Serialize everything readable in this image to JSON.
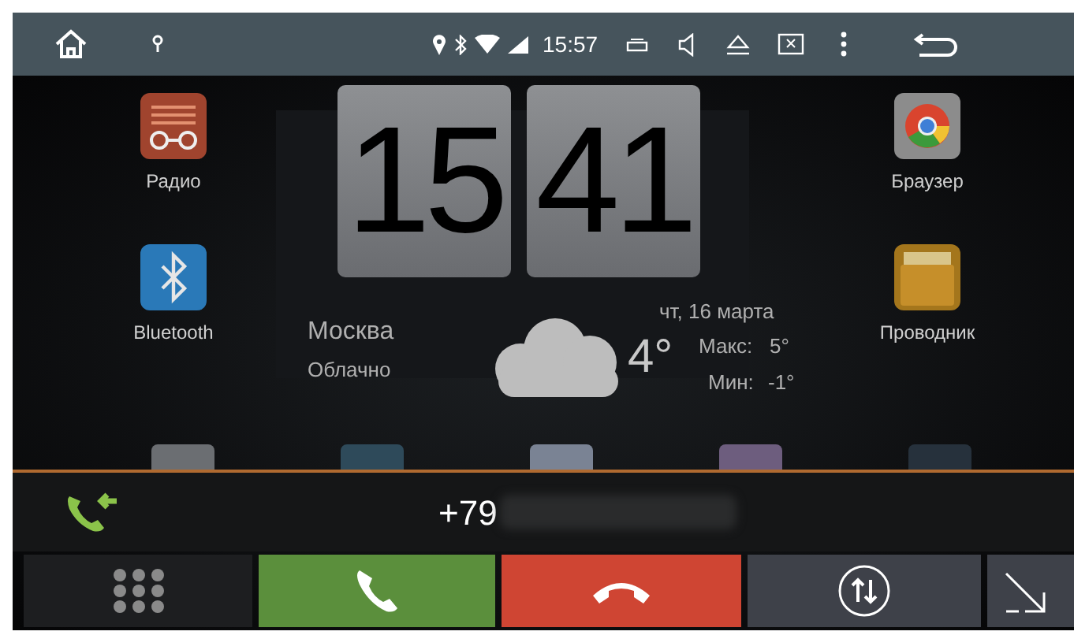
{
  "status_bar": {
    "time": "15:57"
  },
  "apps_left": [
    {
      "label": "Радио",
      "kind": "radio"
    },
    {
      "label": "Bluetooth",
      "kind": "bluetooth"
    }
  ],
  "apps_right": [
    {
      "label": "Браузер",
      "kind": "browser"
    },
    {
      "label": "Проводник",
      "kind": "files"
    }
  ],
  "clock": {
    "hours": "15",
    "minutes": "41"
  },
  "weather": {
    "city": "Москва",
    "condition": "Облачно",
    "date": "чт, 16 марта",
    "temperature": "4°",
    "max_label": "Макс:",
    "max_value": "5°",
    "min_label": "Мин:",
    "min_value": "-1°"
  },
  "call": {
    "number": "+79"
  },
  "buttons": [
    {
      "kind": "keypad"
    },
    {
      "kind": "answer"
    },
    {
      "kind": "hangup"
    },
    {
      "kind": "switch"
    },
    {
      "kind": "minimize"
    }
  ]
}
